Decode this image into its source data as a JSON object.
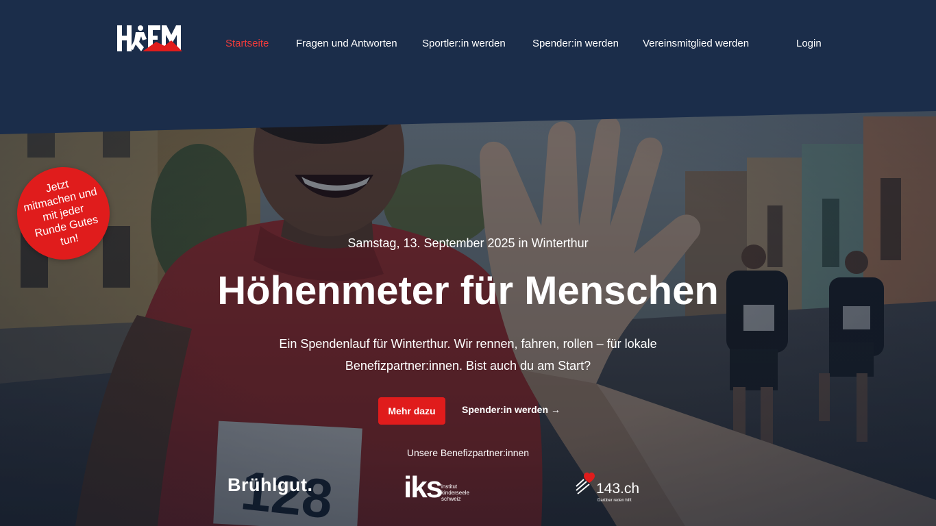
{
  "nav": {
    "logo_alt": "HFM",
    "items": [
      {
        "label": "Startseite",
        "active": true
      },
      {
        "label": "Fragen und Antworten",
        "active": false
      },
      {
        "label": "Sportler:in werden",
        "active": false
      },
      {
        "label": "Spender:in werden",
        "active": false
      },
      {
        "label": "Vereinsmitglied werden",
        "active": false
      },
      {
        "label": "Login",
        "active": false
      }
    ]
  },
  "badge": {
    "text": "Jetzt mitmachen und mit jeder Runde Gutes tun!"
  },
  "hero": {
    "date_line": "Samstag, 13. September 2025 in Winterthur",
    "headline": "Höhenmeter für Menschen",
    "lead": "Ein Spendenlauf für Winterthur. Wir rennen, fahren, rollen – für lokale Benefizpartner:innen. Bist auch du am Start?",
    "primary_button": "Mehr dazu",
    "secondary_link": "Spender:in werden →",
    "runner_bib": "128"
  },
  "partners": {
    "title": "Unsere Benefizpartner:innen",
    "items": [
      {
        "name": "Brühlgut."
      },
      {
        "mark": "iks",
        "subtitle": "institut kinderseele schweiz"
      },
      {
        "name": "143.ch",
        "tagline": "Darüber reden hilft"
      }
    ]
  },
  "colors": {
    "navy": "#1b2d4a",
    "accent_red": "#e01c1c",
    "active_link": "#ee3b3b"
  }
}
